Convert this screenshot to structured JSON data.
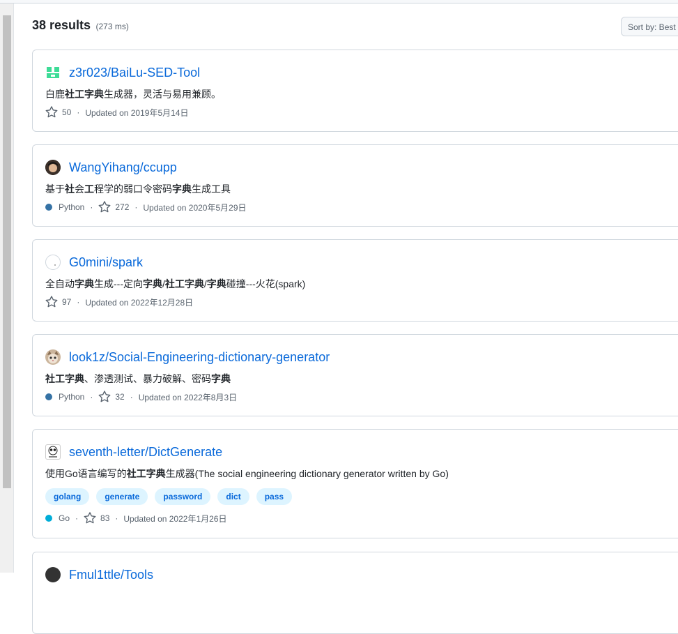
{
  "results": {
    "count": "38 results",
    "time": "(273 ms)"
  },
  "sort": {
    "label": "Sort by: Best match"
  },
  "repos": [
    {
      "name": "z3r023/BaiLu-SED-Tool",
      "desc": [
        {
          "t": "白鹿",
          "b": false
        },
        {
          "t": "社工字典",
          "b": true
        },
        {
          "t": "生成器，灵活与易用兼顾。",
          "b": false
        }
      ],
      "language": "",
      "language_color": "",
      "stars": "50",
      "updated": "Updated on 2019年5月14日",
      "tags": []
    },
    {
      "name": "WangYihang/ccupp",
      "desc": [
        {
          "t": "基于",
          "b": false
        },
        {
          "t": "社",
          "b": true
        },
        {
          "t": "会",
          "b": false
        },
        {
          "t": "工",
          "b": true
        },
        {
          "t": "程学的弱口令密码",
          "b": false
        },
        {
          "t": "字典",
          "b": true
        },
        {
          "t": "生成工具",
          "b": false
        }
      ],
      "language": "Python",
      "language_color": "#3572A5",
      "stars": "272",
      "updated": "Updated on 2020年5月29日",
      "tags": []
    },
    {
      "name": "G0mini/spark",
      "desc": [
        {
          "t": "全自动",
          "b": false
        },
        {
          "t": "字典",
          "b": true
        },
        {
          "t": "生成---定向",
          "b": false
        },
        {
          "t": "字典",
          "b": true
        },
        {
          "t": "/",
          "b": false
        },
        {
          "t": "社工字典",
          "b": true
        },
        {
          "t": "/",
          "b": false
        },
        {
          "t": "字典",
          "b": true
        },
        {
          "t": "碰撞---火花(spark)",
          "b": false
        }
      ],
      "language": "",
      "language_color": "",
      "stars": "97",
      "updated": "Updated on 2022年12月28日",
      "tags": []
    },
    {
      "name": "look1z/Social-Engineering-dictionary-generator",
      "desc": [
        {
          "t": "社工字典",
          "b": true
        },
        {
          "t": "、渗透测试、暴力破解、密码",
          "b": false
        },
        {
          "t": "字典",
          "b": true
        }
      ],
      "language": "Python",
      "language_color": "#3572A5",
      "stars": "32",
      "updated": "Updated on 2022年8月3日",
      "tags": []
    },
    {
      "name": "seventh-letter/DictGenerate",
      "desc": [
        {
          "t": "使用Go语言编写的",
          "b": false
        },
        {
          "t": "社工字典",
          "b": true
        },
        {
          "t": "生成器(The social engineering dictionary generator written by Go)",
          "b": false
        }
      ],
      "language": "Go",
      "language_color": "#00ADD8",
      "stars": "83",
      "updated": "Updated on 2022年1月26日",
      "tags": [
        "golang",
        "generate",
        "password",
        "dict",
        "pass"
      ]
    },
    {
      "name": "Fmul1ttle/Tools",
      "desc": [],
      "language": "",
      "language_color": "",
      "stars": "",
      "updated": "",
      "tags": []
    }
  ]
}
